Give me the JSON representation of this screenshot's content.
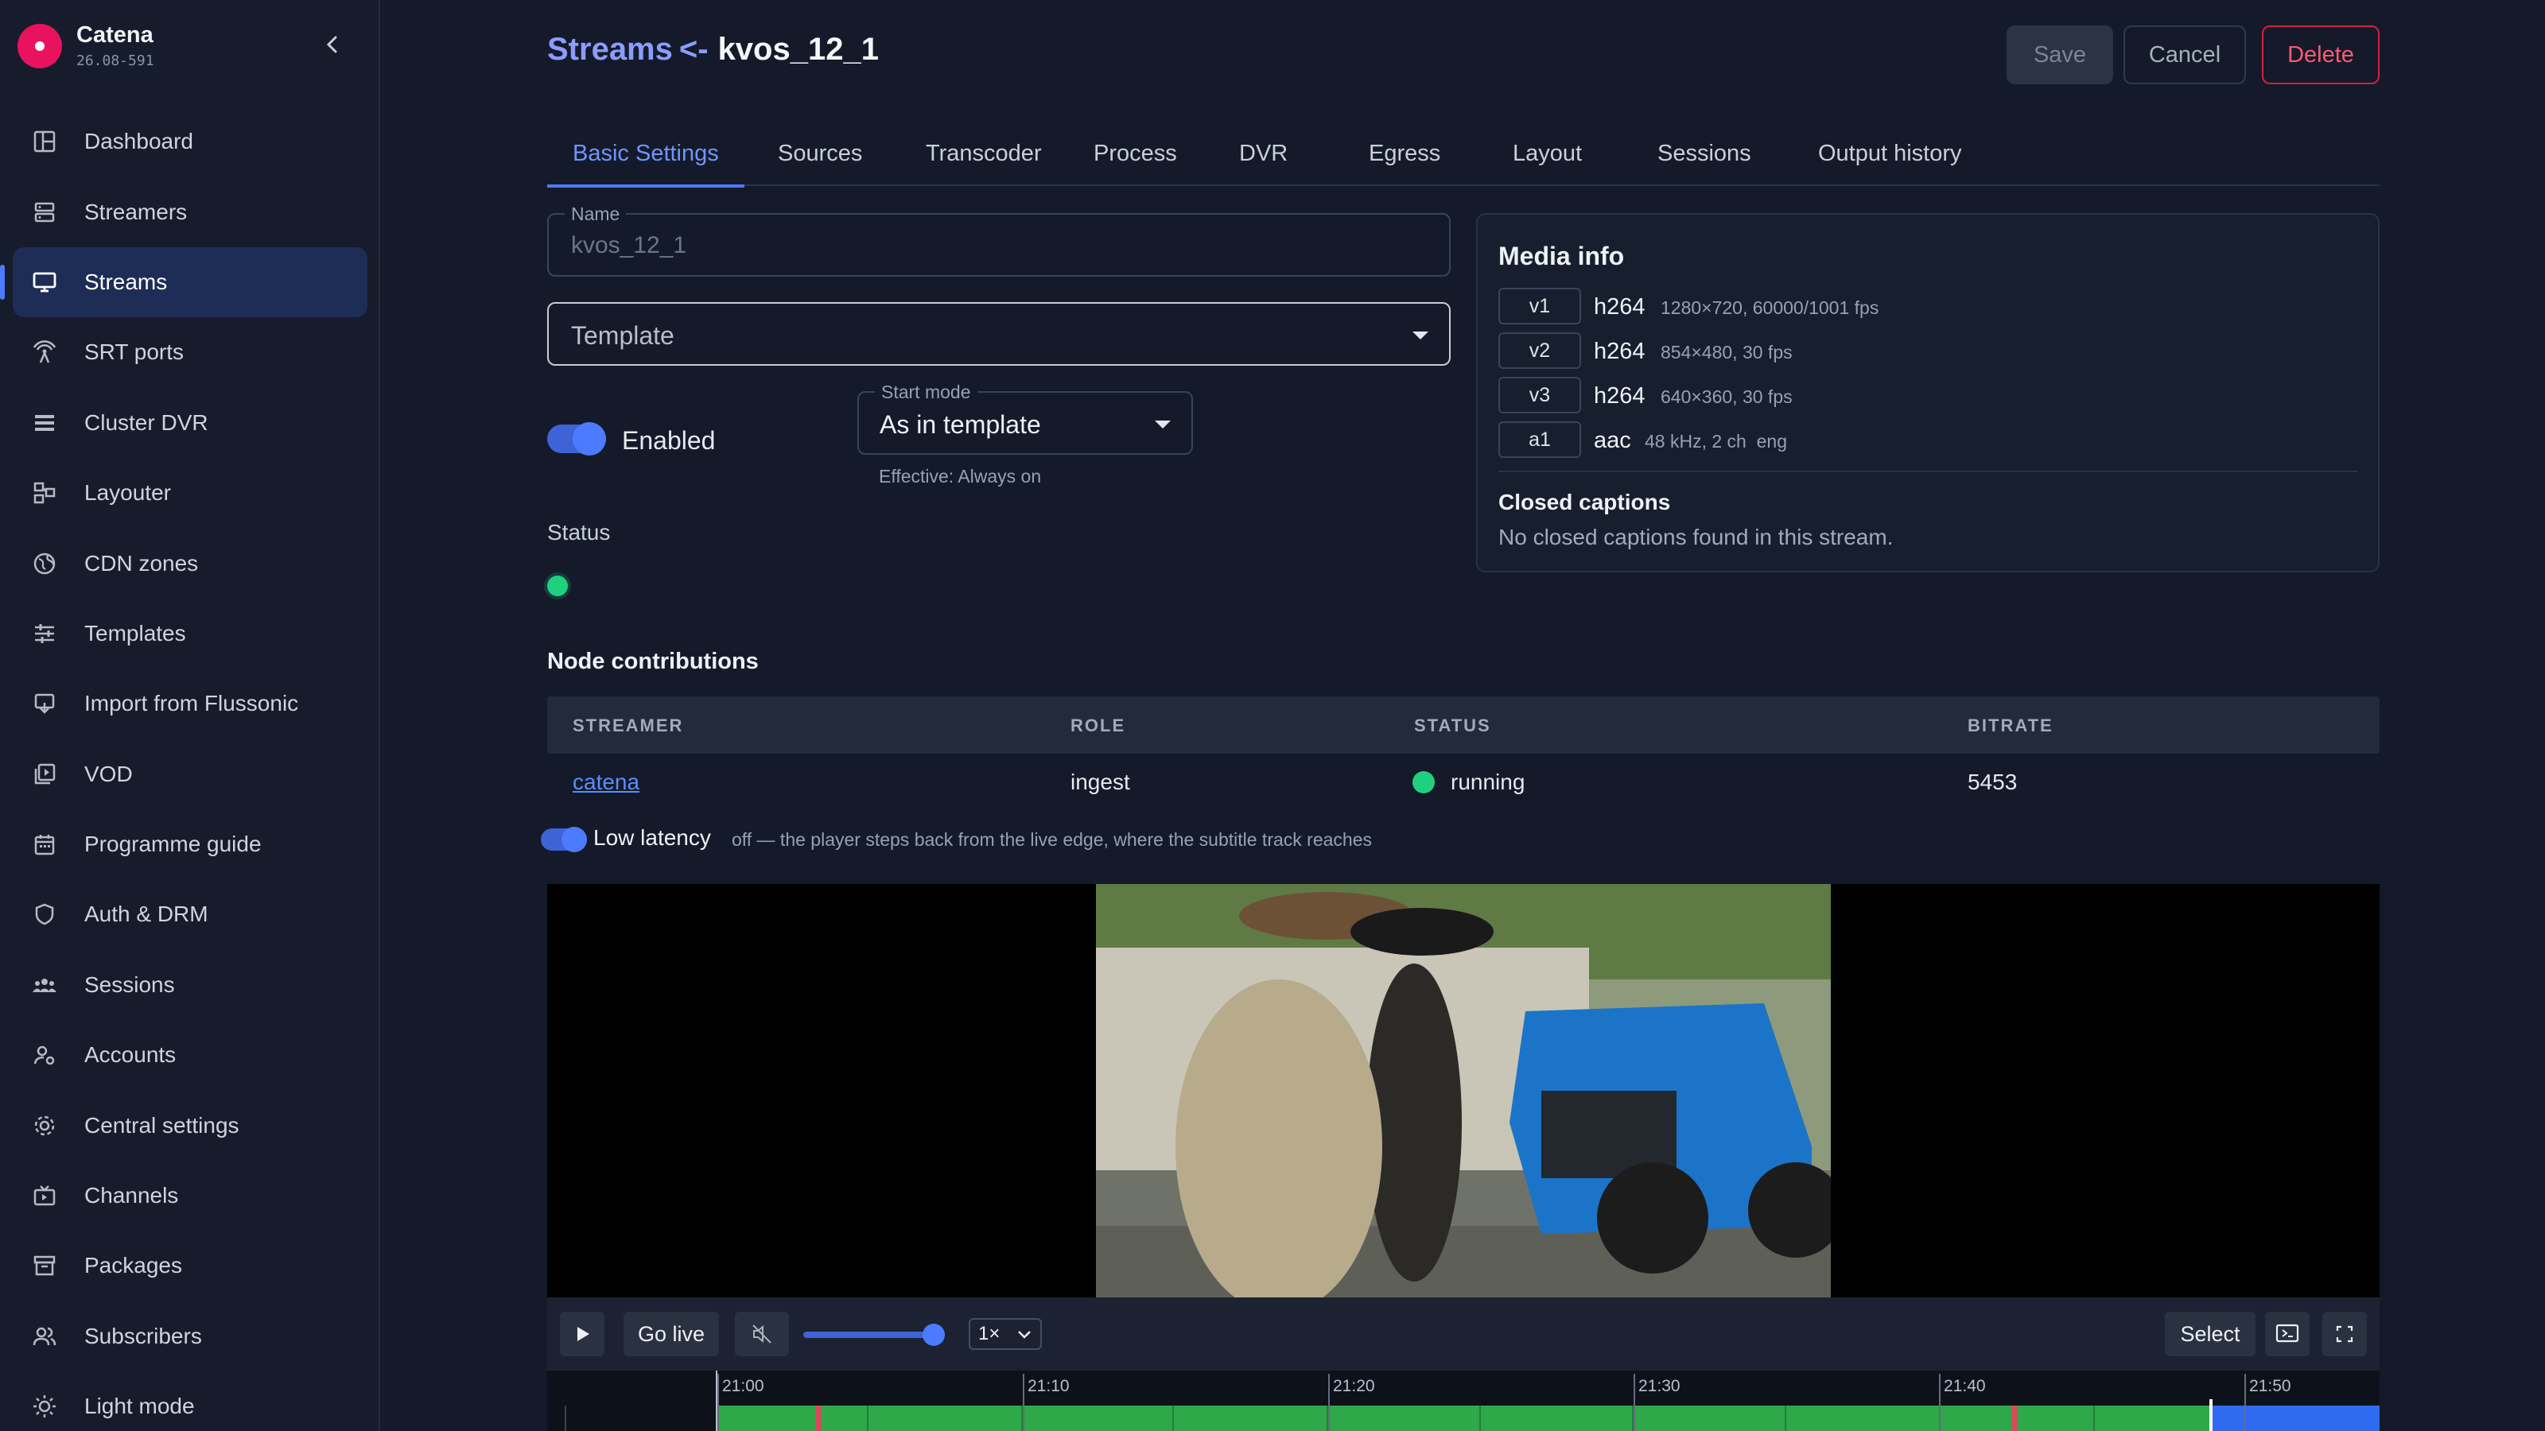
{
  "brand": {
    "name": "Catena",
    "version": "26.08-591"
  },
  "sidebar": {
    "items": [
      {
        "label": "Dashboard",
        "icon": "dashboard-icon"
      },
      {
        "label": "Streamers",
        "icon": "server-icon"
      },
      {
        "label": "Streams",
        "icon": "monitor-icon",
        "active": true
      },
      {
        "label": "SRT ports",
        "icon": "antenna-icon"
      },
      {
        "label": "Cluster DVR",
        "icon": "list-icon"
      },
      {
        "label": "Layouter",
        "icon": "layout-icon"
      },
      {
        "label": "CDN zones",
        "icon": "globe-icon"
      },
      {
        "label": "Templates",
        "icon": "sliders-icon"
      },
      {
        "label": "Import from Flussonic",
        "icon": "import-icon"
      },
      {
        "label": "VOD",
        "icon": "video-library-icon"
      },
      {
        "label": "Programme guide",
        "icon": "calendar-icon"
      },
      {
        "label": "Auth & DRM",
        "icon": "shield-icon"
      },
      {
        "label": "Sessions",
        "icon": "group-icon"
      },
      {
        "label": "Accounts",
        "icon": "user-settings-icon"
      },
      {
        "label": "Central settings",
        "icon": "gear-icon"
      },
      {
        "label": "Channels",
        "icon": "tv-icon"
      },
      {
        "label": "Packages",
        "icon": "archive-icon"
      },
      {
        "label": "Subscribers",
        "icon": "users-icon"
      },
      {
        "label": "Light mode",
        "icon": "sun-icon"
      }
    ]
  },
  "header": {
    "crumb": "Streams",
    "arrow": "<-",
    "title": "kvos_12_1",
    "save": "Save",
    "cancel": "Cancel",
    "delete": "Delete"
  },
  "tabs": [
    "Basic Settings",
    "Sources",
    "Transcoder",
    "Process",
    "DVR",
    "Egress",
    "Layout",
    "Sessions",
    "Output history"
  ],
  "form": {
    "name_label": "Name",
    "name_value": "kvos_12_1",
    "template_placeholder": "Template",
    "enabled_label": "Enabled",
    "enabled": true,
    "start_mode_label": "Start mode",
    "start_mode_value": "As in template",
    "effective": "Effective: Always on",
    "status_label": "Status",
    "status_color": "#1fd07f"
  },
  "media_info": {
    "title": "Media info",
    "tracks": [
      {
        "id": "v1",
        "codec": "h264",
        "info": "1280×720, 60000/1001 fps"
      },
      {
        "id": "v2",
        "codec": "h264",
        "info": "854×480, 30 fps"
      },
      {
        "id": "v3",
        "codec": "h264",
        "info": "640×360, 30 fps"
      },
      {
        "id": "a1",
        "codec": "aac",
        "info": "48 kHz, 2 ch  eng"
      }
    ],
    "cc_title": "Closed captions",
    "cc_text": "No closed captions found in this stream."
  },
  "nodes": {
    "title": "Node contributions",
    "columns": [
      "STREAMER",
      "ROLE",
      "STATUS",
      "BITRATE"
    ],
    "rows": [
      {
        "streamer": "catena",
        "role": "ingest",
        "status": "running",
        "bitrate": "5453"
      }
    ]
  },
  "player": {
    "low_latency_label": "Low latency",
    "low_latency_note": "off — the player steps back from the live edge, where the subtitle track reaches",
    "go_live": "Go live",
    "speed": "1×",
    "select": "Select",
    "volume": 1.0,
    "timeline_labels": [
      "21:00",
      "21:10",
      "21:20",
      "21:30",
      "21:40",
      "21:50"
    ]
  },
  "colors": {
    "accent": "#4c7bff",
    "danger": "#ff5a72",
    "ok": "#1fd07f",
    "timeline": "#2fa84a"
  }
}
